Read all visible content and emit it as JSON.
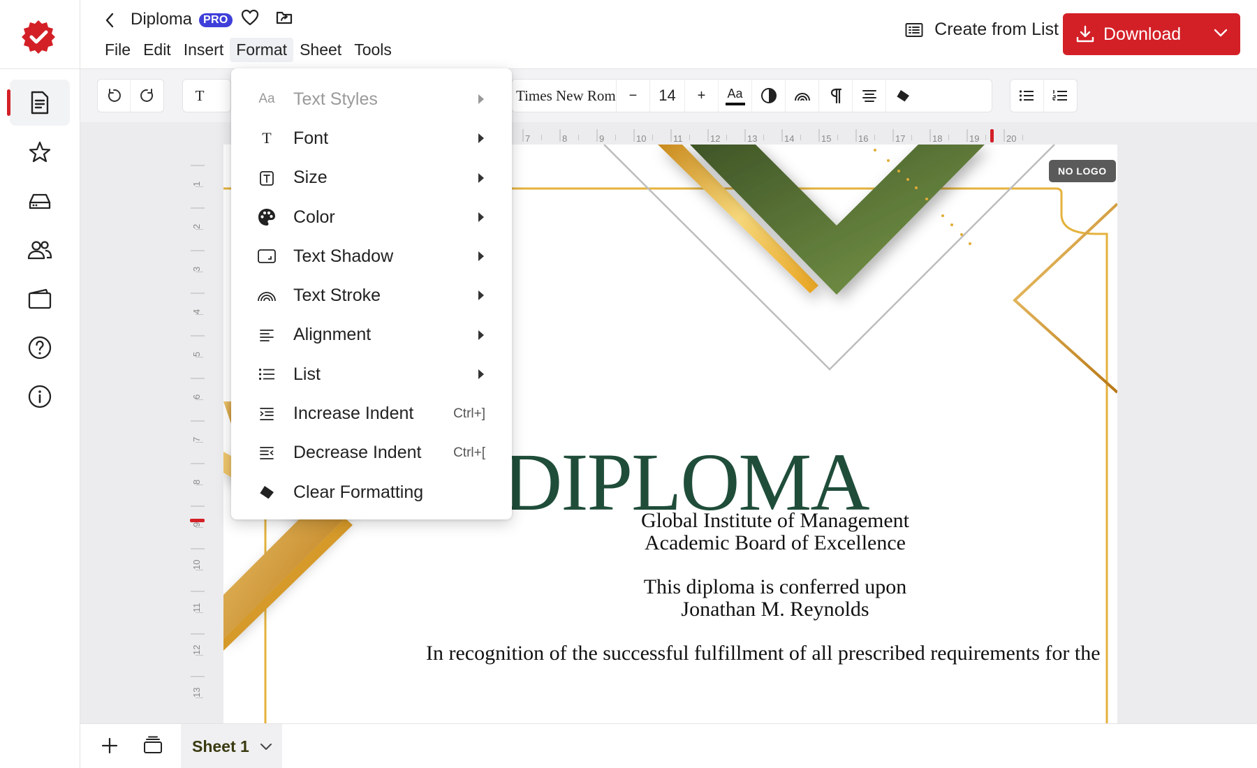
{
  "app": {
    "doc_title": "Diploma",
    "badge": "PRO",
    "brand_color": "#d32027",
    "badge_color": "#3f3fd9"
  },
  "menubar": [
    "File",
    "Edit",
    "Insert",
    "Format",
    "Sheet",
    "Tools"
  ],
  "actions": {
    "create_from_list": "Create from List",
    "download": "Download"
  },
  "sidebar": {
    "items": [
      {
        "icon": "document-icon",
        "active": true
      },
      {
        "icon": "star-icon"
      },
      {
        "icon": "drive-icon"
      },
      {
        "icon": "users-icon"
      },
      {
        "icon": "wallet-icon"
      },
      {
        "icon": "help-icon"
      },
      {
        "icon": "info-icon"
      }
    ]
  },
  "toolbar": {
    "font_name": "Times New Roman",
    "font_size": "14",
    "decrease": "−",
    "increase": "+",
    "text_style": "Aa",
    "text_tool": "T"
  },
  "ruler": {
    "top_labels": [
      "7",
      "8",
      "9",
      "10",
      "11",
      "12",
      "13",
      "14",
      "15",
      "16",
      "17",
      "18",
      "19",
      "20"
    ],
    "left_labels": [
      "1",
      "2",
      "3",
      "4",
      "5",
      "6",
      "7",
      "8",
      "9",
      "10",
      "11",
      "12",
      "13"
    ]
  },
  "format_menu": {
    "items": [
      {
        "label": "Text Styles",
        "icon_text": "Aa",
        "submenu": true,
        "disabled": true
      },
      {
        "label": "Font",
        "icon_text": "T",
        "submenu": true
      },
      {
        "label": "Size",
        "submenu": true
      },
      {
        "label": "Color",
        "submenu": true
      },
      {
        "label": "Text Shadow",
        "submenu": true
      },
      {
        "label": "Text Stroke",
        "submenu": true
      },
      {
        "label": "Alignment",
        "submenu": true
      },
      {
        "label": "List",
        "submenu": true
      },
      {
        "label": "Increase Indent",
        "shortcut": "Ctrl+]"
      },
      {
        "label": "Decrease Indent",
        "shortcut": "Ctrl+["
      },
      {
        "label": "Clear Formatting"
      }
    ]
  },
  "certificate": {
    "title": "DIPLOMA",
    "institution": "Global Institute of Management",
    "board": "Academic Board of Excellence",
    "conferred": "This diploma is conferred upon",
    "recipient": "Jonathan M. Reynolds",
    "recognition": "In recognition of the successful fulfillment of all prescribed requirements for the",
    "no_logo": "NO LOGO",
    "title_color": "#1f4d3a"
  },
  "sheets": {
    "active": "Sheet 1"
  }
}
